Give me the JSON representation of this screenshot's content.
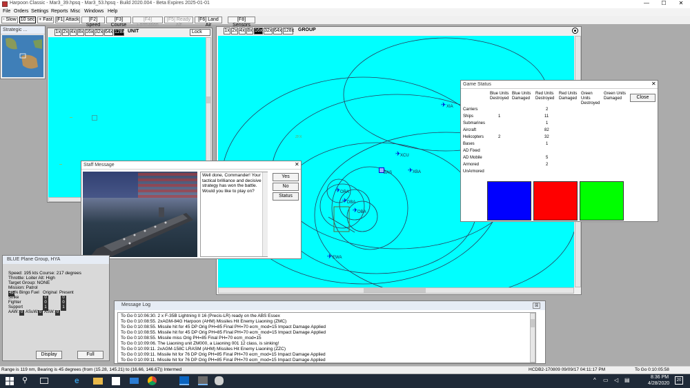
{
  "app": {
    "title": "Harpoon Classic - Mar3_39.hpsq - Mar3_53.hpsq - Build 2020.004 - Beta Expires 2025-01-01",
    "window_controls": [
      "—",
      "☐",
      "✕"
    ]
  },
  "menu": [
    "File",
    "Orders",
    "Settings",
    "Reports",
    "Misc",
    "Windows",
    "Help"
  ],
  "toolbar": {
    "buttons": [
      "- Slow",
      "10 sec",
      "+ Fast",
      "[F1] Attack",
      "[F2] Speed",
      "[F3] Course",
      "[F4] Formation",
      "[F5] Ready Air",
      "[F6] Land Air",
      "[F8] Sensors"
    ]
  },
  "strategic": {
    "title": "Strategic ..."
  },
  "unit_window": {
    "zoom": [
      "1x",
      "2x",
      "4x",
      "8x",
      "16x",
      "32x",
      "64x",
      "128x"
    ],
    "selected_zoom": "128x",
    "label": "UNIT",
    "lock_label": "Lock"
  },
  "group_window": {
    "zoom": [
      "1x",
      "2x",
      "4x",
      "8x",
      "16x",
      "32x",
      "64x",
      "128x"
    ],
    "selected_zoom": "16x",
    "label": "GROUP",
    "units": [
      "XIA",
      "BAS",
      "XCU",
      "XBA",
      "ORA",
      "DBA",
      "OBA",
      "EWA",
      "ZFX"
    ]
  },
  "staff_message": {
    "title": "Staff Message",
    "text": "Well done, Commander! Your tactical brilliance and decisive strategy has won the battle. Would you like to play on?",
    "buttons": [
      "Yes",
      "No",
      "Status"
    ]
  },
  "game_status": {
    "title": "Game Status",
    "columns": [
      "Blue Units Destroyed",
      "Blue Units Damaged",
      "Red Units Destroyed",
      "Red Units Damaged",
      "Green Units Destroyed",
      "Green Units Damaged"
    ],
    "close_label": "Close",
    "rows": [
      {
        "label": "Carriers",
        "values": [
          "",
          "",
          "2",
          "",
          "",
          ""
        ]
      },
      {
        "label": "Ships",
        "values": [
          "1",
          "",
          "11",
          "",
          "",
          ""
        ]
      },
      {
        "label": "Submarines",
        "values": [
          "",
          "",
          "1",
          "",
          "",
          ""
        ]
      },
      {
        "label": "Aircraft",
        "values": [
          "",
          "",
          "82",
          "",
          "",
          ""
        ]
      },
      {
        "label": "Helicopters",
        "values": [
          "2",
          "",
          "32",
          "",
          "",
          ""
        ]
      },
      {
        "label": "Bases",
        "values": [
          "",
          "",
          "1",
          "",
          "",
          ""
        ]
      },
      {
        "label": "AD Fixed",
        "values": [
          "",
          "",
          "",
          "",
          "",
          ""
        ]
      },
      {
        "label": "AD Mobile",
        "values": [
          "",
          "",
          "5",
          "",
          "",
          ""
        ]
      },
      {
        "label": "Armored",
        "values": [
          "",
          "",
          "2",
          "",
          "",
          ""
        ]
      },
      {
        "label": "UnArmored",
        "values": [
          "",
          "",
          "",
          "",
          "",
          ""
        ]
      }
    ],
    "swatches": [
      "#0000ff",
      "#ff0000",
      "#00ff00"
    ]
  },
  "plane_group": {
    "title": "BLUE Plane Group, HYA",
    "speed_line": "Speed: 195 kts   Course: 217 degrees",
    "throttle_line": "Throttle: Loiter   Alt: High",
    "target_line": "Target Group: NONE",
    "mission_line": "Mission: Patrol",
    "bingo_value": "45",
    "bingo_label": "% Bingo Fuel",
    "original_label": "Original",
    "present_label": "Present",
    "rows": [
      {
        "label": "Strike",
        "original": "0",
        "present": "0"
      },
      {
        "label": "Fighter",
        "original": "0",
        "present": "0"
      },
      {
        "label": "Support",
        "original": "1",
        "present": "1"
      }
    ],
    "aaw_line": "AAW:",
    "aaw_val": "0",
    "asuw_label": "ASuW:",
    "asuw_val": "0",
    "asw_label": "ASW:",
    "asw_val": "0",
    "display_label": "Display",
    "full_label": "Full"
  },
  "message_log": {
    "title": "Message Log",
    "lines": [
      "To Go 0:10:06:30. 2 x F-35B Lightning II 16 (Precis-LR) ready on the ABS Essex",
      "To Go 0:10:08:55. 2xAGM-84G Harpoon (AHM) Missiles Hit Enemy Liaoning (ZMC)",
      "To Go 0:10:08:55. Missile hit for 45 DP Orig PH=85 Final PH=70 ecm_mod=15 Impact Damage Applied",
      "To Go 0:10:08:55. Missile hit for 45 DP Orig PH=85 Final PH=70 ecm_mod=15 Impact Damage Applied",
      "To Go 0:10:08:55. Missile miss Orig PH=85 Final PH=70 ecm_mod=15",
      "To Go 0:10:09:06. The Liaoning unit ZM000, a Liaoning 001 12 class, is sinking!",
      "To Go 0:10:09:11. 2xAGM-158C LRASM (AHM) Missiles Hit Enemy Liaoning (ZZC)",
      "To Go 0:10:09:11. Missile hit for 76 DP Orig PH=85 Final PH=70 ecm_mod=15 Impact Damage Applied",
      "To Go 0:10:09:11. Missile hit for 76 DP Orig PH=85 Final PH=70 ecm_mod=15 Impact Damage Applied"
    ]
  },
  "status_bar": {
    "left": "Range is 119 nm, Bearing is 45 degrees (from (15.28, 145.21) to (16.66, 146.67)) Intermed",
    "mid": "HCDB2-170809 09/09/17 04:11:17 PM",
    "right": "To Go 0:10:05:58"
  },
  "taskbar": {
    "search_placeholder": "Type here to search",
    "time": "8:36 PM",
    "date": "4/28/2020",
    "notif_count": "20"
  },
  "colors": {
    "sea": "#00ffff",
    "blue_unit": "#0000cc"
  }
}
